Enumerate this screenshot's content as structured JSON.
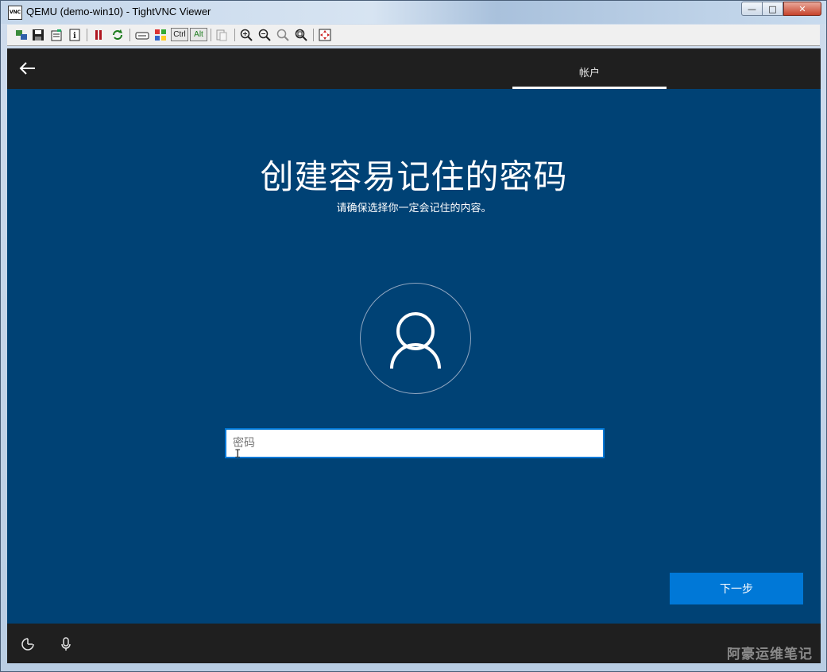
{
  "window": {
    "title": "QEMU (demo-win10) - TightVNC Viewer",
    "app_icon_text": "VNC",
    "controls": {
      "minimize": "—",
      "maximize": "□",
      "close": "✕"
    }
  },
  "toolbar": {
    "ctrl_label": "Ctrl",
    "alt_label": "Alt",
    "icons": [
      "new-connection-icon",
      "save-icon",
      "options-icon",
      "info-icon",
      "pause-icon",
      "refresh-icon",
      "send-ctrl-alt-del-icon",
      "send-ctrl-esc-icon",
      "ctrl-toggle",
      "alt-toggle",
      "clipboard-icon",
      "zoom-in-icon",
      "zoom-out-icon",
      "zoom-100-icon",
      "zoom-fit-icon",
      "fullscreen-icon"
    ]
  },
  "oobe": {
    "tab_label": "帐户",
    "heading": "创建容易记住的密码",
    "subheading": "请确保选择你一定会记住的内容。",
    "password_placeholder": "密码",
    "password_value": "",
    "next_button": "下一步",
    "watermark": "阿豪运维笔记"
  },
  "colors": {
    "background": "#004275",
    "bar": "#1f1f1f",
    "accent": "#0078d7",
    "text": "#ffffff"
  }
}
